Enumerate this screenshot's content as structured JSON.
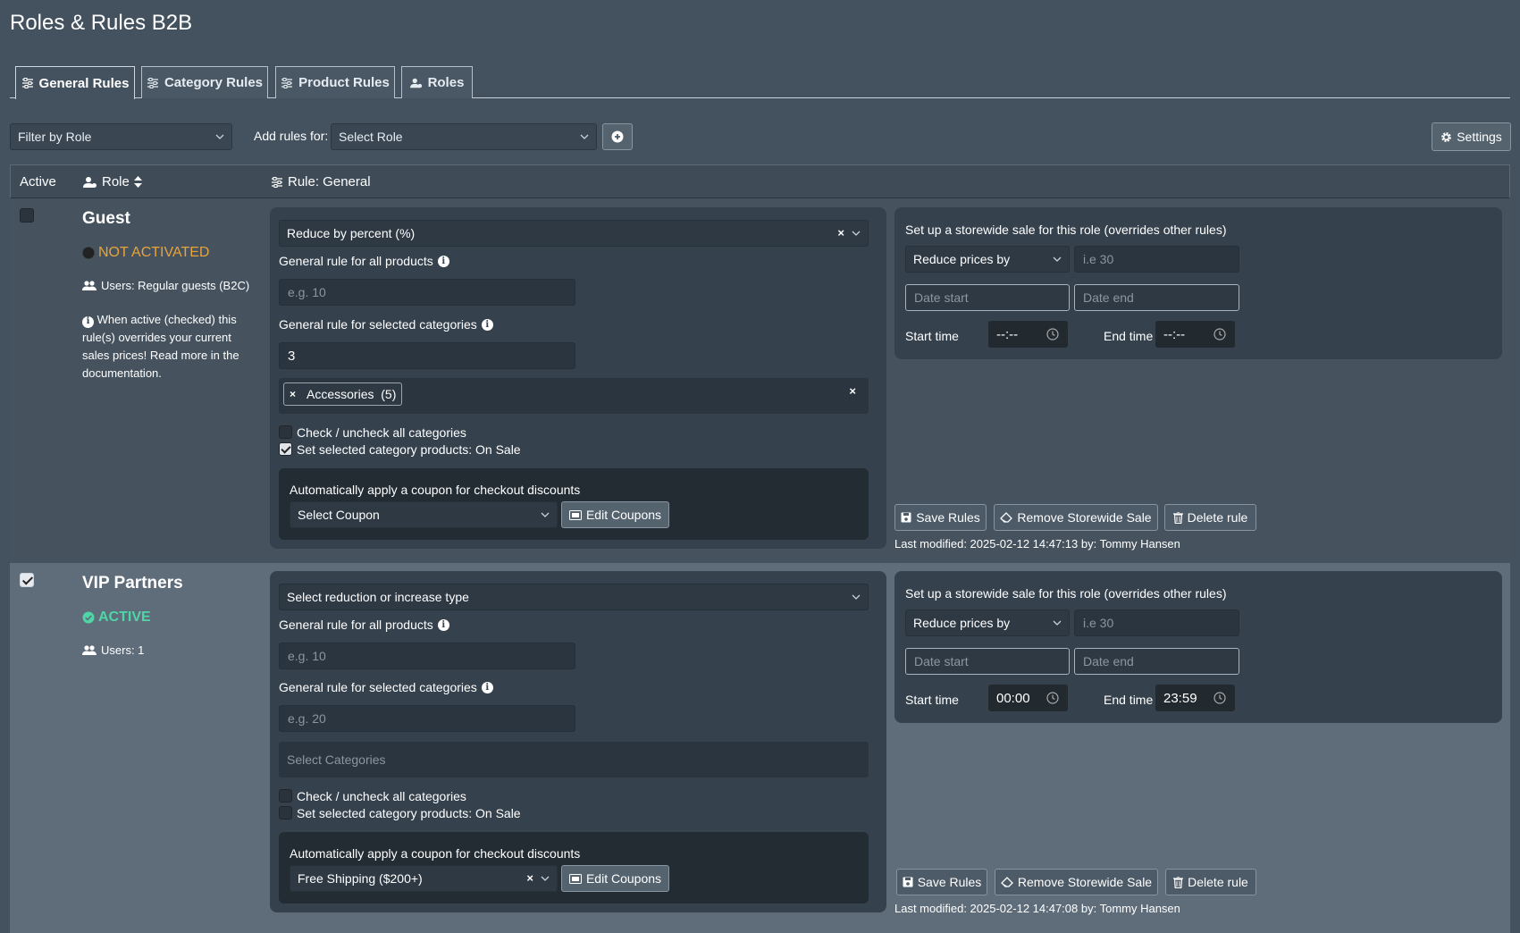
{
  "app": {
    "title": "Roles & Rules B2B"
  },
  "tabs": [
    {
      "label": "General Rules",
      "icon": "sliders-icon",
      "active": true
    },
    {
      "label": "Category Rules",
      "icon": "sliders-icon"
    },
    {
      "label": "Product Rules",
      "icon": "sliders-icon"
    },
    {
      "label": "Roles",
      "icon": "user-gear-icon"
    }
  ],
  "toolbar": {
    "filter_placeholder": "Filter by Role",
    "add_rules_label": "Add rules for:",
    "select_role_placeholder": "Select Role",
    "settings_label": "Settings"
  },
  "table": {
    "col_active": "Active",
    "col_role": "Role",
    "col_rule": "Rule: General"
  },
  "rows": [
    {
      "checked": false,
      "role": "Guest",
      "status": "NOT ACTIVATED",
      "status_color": "#e8a33a",
      "users": "Users: Regular guests (B2C)",
      "note": "When active (checked) this rule(s) overrides your current sales prices! Read more in the documentation.",
      "reduction_type": "Reduce by percent (%)",
      "general_all_label": "General rule for all products",
      "general_all_placeholder": "e.g. 10",
      "general_cat_label": "General rule for selected categories",
      "general_cat_value": "3",
      "category_tag": "Accessories  (5)",
      "check_all_label": "Check / uncheck all categories",
      "check_all_checked": false,
      "on_sale_label": "Set selected category products: On Sale",
      "on_sale_checked": true,
      "coupon_label": "Automatically apply a coupon for checkout discounts",
      "coupon_value": "Select Coupon",
      "edit_coupons": "Edit Coupons",
      "storewide_title": "Set up a storewide sale for this role (overrides other rules)",
      "storewide_type": "Reduce prices by",
      "storewide_amount_placeholder": "i.e 30",
      "date_start_placeholder": "Date start",
      "date_end_placeholder": "Date end",
      "start_time_label": "Start time",
      "start_time_value": "--:--",
      "end_time_label": "End time",
      "end_time_value": "--:--",
      "save_label": "Save Rules",
      "remove_label": "Remove Storewide Sale",
      "delete_label": "Delete rule",
      "modified": "Last modified: 2025-02-12 14:47:13 by: Tommy Hansen"
    },
    {
      "checked": true,
      "role": "VIP Partners",
      "status": "ACTIVE",
      "status_color": "#4fd6a6",
      "users": "Users: 1",
      "reduction_type": "Select reduction or increase type",
      "general_all_label": "General rule for all products",
      "general_all_placeholder": "e.g. 10",
      "general_cat_label": "General rule for selected categories",
      "general_cat_placeholder": "e.g. 20",
      "categories_placeholder": "Select Categories",
      "check_all_label": "Check / uncheck all categories",
      "check_all_checked": false,
      "on_sale_label": "Set selected category products: On Sale",
      "on_sale_checked": false,
      "coupon_label": "Automatically apply a coupon for checkout discounts",
      "coupon_value": "Free Shipping ($200+)",
      "edit_coupons": "Edit Coupons",
      "storewide_title": "Set up a storewide sale for this role (overrides other rules)",
      "storewide_type": "Reduce prices by",
      "storewide_amount_placeholder": "i.e 30",
      "date_start_placeholder": "Date start",
      "date_end_placeholder": "Date end",
      "start_time_label": "Start time",
      "start_time_value": "00:00",
      "end_time_label": "End time",
      "end_time_value": "23:59",
      "save_label": "Save Rules",
      "remove_label": "Remove Storewide Sale",
      "delete_label": "Delete rule",
      "modified": "Last modified: 2025-02-12 14:47:08 by: Tommy Hansen"
    }
  ]
}
